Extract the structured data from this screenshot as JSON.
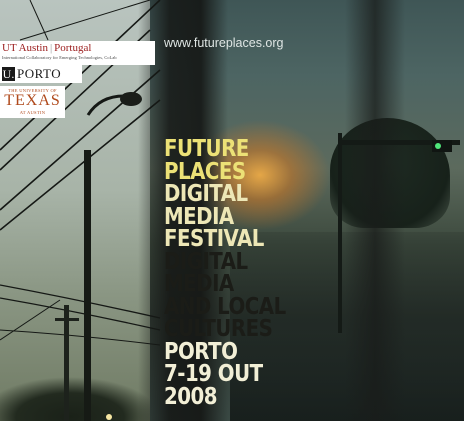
{
  "website": "www.futureplaces.org",
  "logos": {
    "ut_austin_portugal": {
      "name": "UT Austin",
      "separator": "|",
      "region": "Portugal",
      "subtitle": "International Collaboratory for Emerging Technologies, CoLab"
    },
    "u_porto": {
      "mark": "U.",
      "name": "PORTO"
    },
    "ut_texas": {
      "top": "THE UNIVERSITY OF",
      "name": "TEXAS",
      "bottom": "AT AUSTIN"
    }
  },
  "headline": {
    "future": "FUTURE",
    "places": "PLACES",
    "digital_1": "DIGITAL",
    "media_1": "MEDIA",
    "festival": "FESTIVAL",
    "digital_2": "DIGITAL",
    "media_2": "MEDIA",
    "and_local": "AND LOCAL",
    "cultures": "CULTURES",
    "city": "PORTO",
    "dates": "7-19 OUT",
    "year": "2008"
  }
}
